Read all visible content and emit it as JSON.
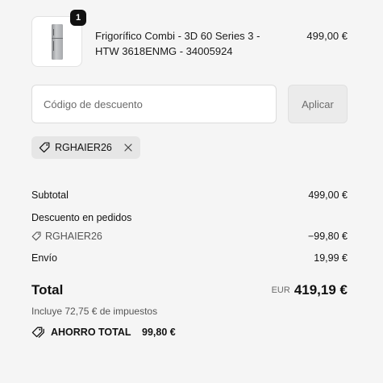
{
  "product": {
    "quantity": "1",
    "name": "Frigorífico Combi - 3D 60 Series 3 - HTW 3618ENMG - 34005924",
    "price": "499,00 €"
  },
  "discount": {
    "placeholder": "Código de descuento",
    "apply_label": "Aplicar",
    "applied_code": "RGHAIER26"
  },
  "summary": {
    "subtotal_label": "Subtotal",
    "subtotal_value": "499,00 €",
    "order_discount_label": "Descuento en pedidos",
    "order_discount_code": "RGHAIER26",
    "order_discount_value": "−99,80 €",
    "shipping_label": "Envío",
    "shipping_value": "19,99 €",
    "total_label": "Total",
    "currency": "EUR",
    "total_value": "419,19 €",
    "taxes_note": "Incluye 72,75 € de impuestos",
    "savings_label": "AHORRO TOTAL",
    "savings_value": "99,80 €"
  },
  "icons": {
    "tag": "tag-icon",
    "close": "close-icon",
    "savings": "tags-icon"
  }
}
